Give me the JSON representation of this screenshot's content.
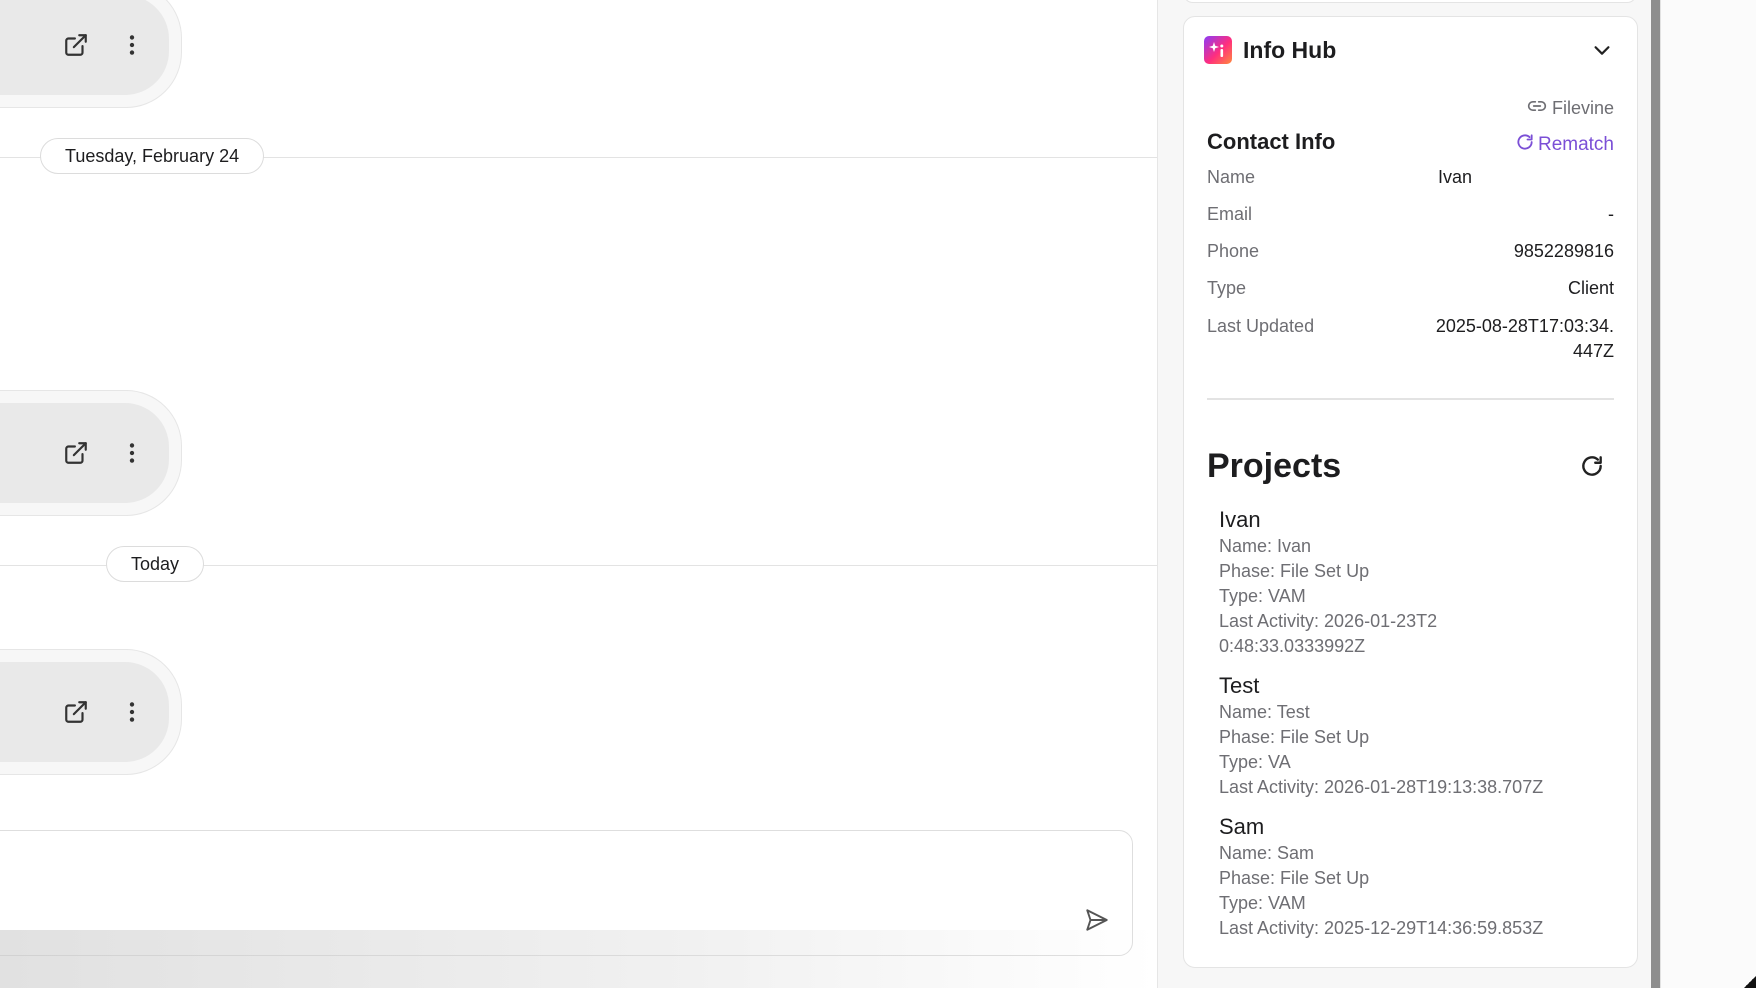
{
  "chat": {
    "date_dividers": [
      "Tuesday, February 24",
      "Today"
    ],
    "message_actions": {
      "open_icon": "external-link-icon",
      "menu_icon": "more-vertical-icon"
    },
    "composer": {
      "placeholder": "",
      "send_icon": "send-icon"
    }
  },
  "info_hub": {
    "title": "Info Hub",
    "filevine_link": "Filevine",
    "contact_info": {
      "title": "Contact Info",
      "rematch_label": "Rematch",
      "fields": [
        {
          "label": "Name",
          "value": "Ivan"
        },
        {
          "label": "Email",
          "value": "-"
        },
        {
          "label": "Phone",
          "value": "9852289816"
        },
        {
          "label": "Type",
          "value": "Client"
        },
        {
          "label": "Last Updated",
          "value": "2025-08-28T17:03:34.447Z"
        }
      ]
    },
    "projects": {
      "title": "Projects",
      "items": [
        {
          "title": "Ivan",
          "name": "Name: Ivan",
          "phase": "Phase: File Set Up",
          "type": "Type: VAM",
          "last_activity": "Last Activity: 2026-01-23T20:48:33.0333992Z"
        },
        {
          "title": "Test",
          "name": "Name: Test",
          "phase": "Phase: File Set Up",
          "type": "Type: VA",
          "last_activity": "Last Activity: 2026-01-28T19:13:38.707Z"
        },
        {
          "title": "Sam",
          "name": "Name: Sam",
          "phase": "Phase: File Set Up",
          "type": "Type: VAM",
          "last_activity": "Last Activity: 2025-12-29T14:36:59.853Z"
        }
      ]
    }
  },
  "colors": {
    "accent": "#7b4fd6",
    "muted_text": "#6e6e73",
    "border": "#e4e4e4"
  }
}
